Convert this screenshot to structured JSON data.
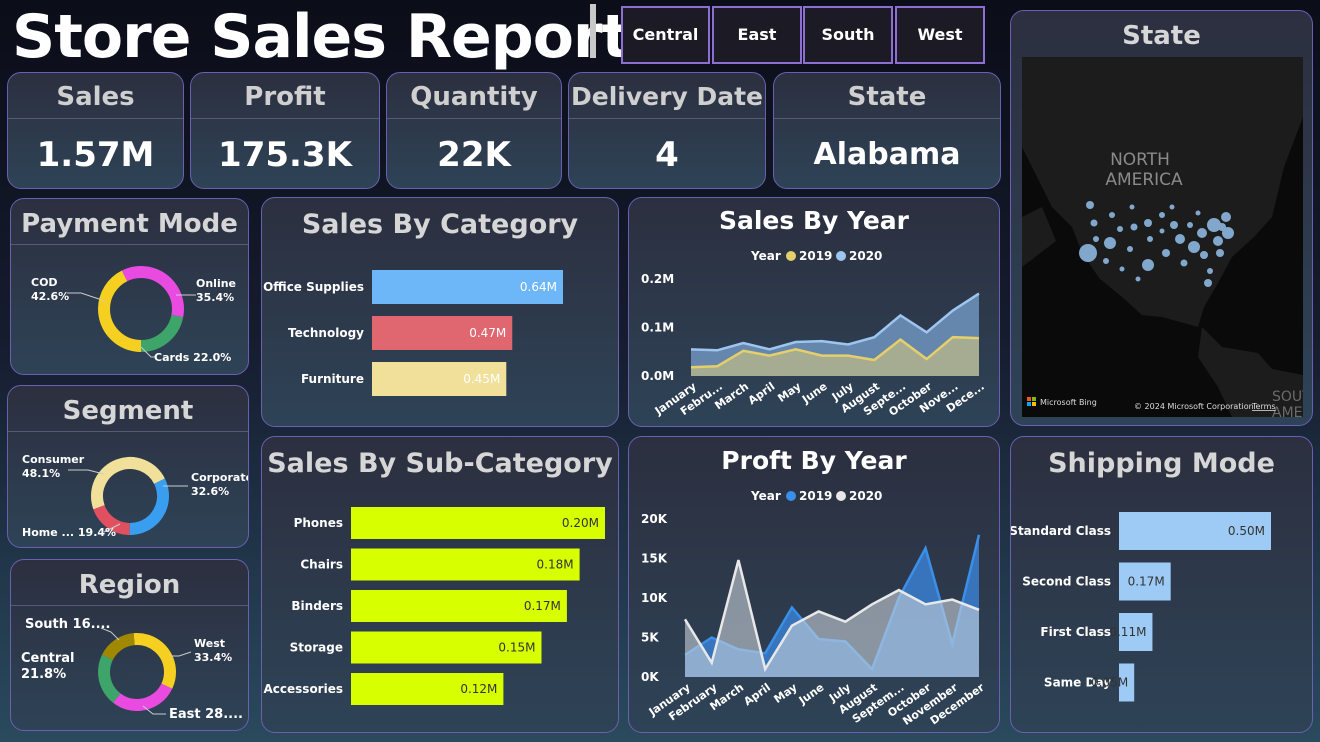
{
  "report_title": "Store Sales Report",
  "region_slicer": [
    "Central",
    "East",
    "South",
    "West"
  ],
  "kpis": {
    "sales": {
      "label": "Sales",
      "value": "1.57M"
    },
    "profit": {
      "label": "Profit",
      "value": "175.3K"
    },
    "quantity": {
      "label": "Quantity",
      "value": "22K"
    },
    "delivery": {
      "label": "Delivery Date",
      "value": "4"
    },
    "state": {
      "label": "State",
      "value": "Alabama"
    }
  },
  "map": {
    "title": "State",
    "continent_line1": "NORTH",
    "continent_line2": "AMERICA",
    "south_label_line1": "SOUT",
    "south_label_line2": "AMER",
    "bing": "Microsoft Bing",
    "copyright": "© 2024 Microsoft Corporation",
    "terms": "Terms"
  },
  "colors": {
    "accent_border": "#6a5fb0",
    "office_supplies": "#6db6f7",
    "technology": "#e06670",
    "furniture": "#f0e09a",
    "subcategory": "#d8ff00",
    "shipping": "#9ecbf5",
    "year_2019_sales": "#e5cf6a",
    "year_2020_sales": "#9ec5f0",
    "year_2019_profit": "#3a8fe8",
    "year_2020_profit": "#e8e8e8"
  },
  "chart_data": [
    {
      "id": "payment_mode",
      "type": "pie",
      "title": "Payment Mode",
      "slices": [
        {
          "label": "COD",
          "value_label": "42.6%",
          "value": 42.6,
          "color": "#f5d020"
        },
        {
          "label": "Online",
          "value_label": "35.4%",
          "value": 35.4,
          "color": "#e94be0"
        },
        {
          "label": "Cards",
          "value_label": "22.0%",
          "value": 22.0,
          "color": "#3ea56a"
        }
      ]
    },
    {
      "id": "segment",
      "type": "pie",
      "title": "Segment",
      "slices": [
        {
          "label": "Consumer",
          "value_label": "48.1%",
          "value": 48.1,
          "color": "#f0e09a"
        },
        {
          "label": "Corporate",
          "value_label": "32.6%",
          "value": 32.6,
          "color": "#3a9ef0"
        },
        {
          "label": "Home ...",
          "value_label": "19.4%",
          "value": 19.4,
          "color": "#e05060"
        }
      ]
    },
    {
      "id": "region",
      "type": "pie",
      "title": "Region",
      "slices": [
        {
          "label": "West",
          "value_label": "33.4%",
          "value": 33.4,
          "color": "#f5d020"
        },
        {
          "label": "East",
          "value_label": "28....",
          "value": 28.4,
          "color": "#e94be0"
        },
        {
          "label": "Central",
          "value_label": "21.8%",
          "value": 21.8,
          "color": "#3ea56a"
        },
        {
          "label": "South",
          "value_label": "16....",
          "value": 16.4,
          "color": "#a08800"
        }
      ]
    },
    {
      "id": "sales_by_category",
      "type": "bar",
      "title": "Sales By Category",
      "categories": [
        "Office Supplies",
        "Technology",
        "Furniture"
      ],
      "values": [
        0.64,
        0.47,
        0.45
      ],
      "value_labels": [
        "0.64M",
        "0.47M",
        "0.45M"
      ],
      "bar_colors": [
        "#6db6f7",
        "#e06670",
        "#f0e09a"
      ],
      "xlim": [
        0,
        0.64
      ]
    },
    {
      "id": "sales_by_subcategory",
      "type": "bar",
      "title": "Sales By Sub-Category",
      "categories": [
        "Phones",
        "Chairs",
        "Binders",
        "Storage",
        "Accessories"
      ],
      "values": [
        0.2,
        0.18,
        0.17,
        0.15,
        0.12
      ],
      "value_labels": [
        "0.20M",
        "0.18M",
        "0.17M",
        "0.15M",
        "0.12M"
      ],
      "xlim": [
        0,
        0.2
      ]
    },
    {
      "id": "shipping_mode",
      "type": "bar",
      "title": "Shipping Mode",
      "categories": [
        "Standard Class",
        "Second Class",
        "First Class",
        "Same Day"
      ],
      "values": [
        0.5,
        0.17,
        0.11,
        0.05
      ],
      "value_labels": [
        "0.50M",
        "0.17M",
        "0.11M",
        "0.05M"
      ],
      "xlim": [
        0,
        0.5
      ]
    },
    {
      "id": "sales_by_year",
      "type": "area",
      "title": "Sales By Year",
      "legend_title": "Year",
      "categories": [
        "January",
        "Febru...",
        "March",
        "April",
        "May",
        "June",
        "July",
        "August",
        "Septe...",
        "October",
        "Nove...",
        "Dece..."
      ],
      "yticks": [
        "0.0M",
        "0.1M",
        "0.2M"
      ],
      "ylim": [
        0,
        0.2
      ],
      "series": [
        {
          "name": "2020",
          "values": [
            0.055,
            0.053,
            0.068,
            0.055,
            0.07,
            0.072,
            0.065,
            0.08,
            0.125,
            0.09,
            0.135,
            0.17
          ]
        },
        {
          "name": "2019",
          "values": [
            0.018,
            0.02,
            0.052,
            0.042,
            0.055,
            0.042,
            0.042,
            0.033,
            0.075,
            0.035,
            0.08,
            0.078
          ]
        }
      ]
    },
    {
      "id": "profit_by_year",
      "type": "area",
      "title": "Proft By Year",
      "legend_title": "Year",
      "categories": [
        "January",
        "February",
        "March",
        "April",
        "May",
        "June",
        "July",
        "August",
        "Septem...",
        "October",
        "November",
        "December"
      ],
      "yticks": [
        "0K",
        "5K",
        "10K",
        "15K",
        "20K"
      ],
      "ylim": [
        0,
        20000
      ],
      "series": [
        {
          "name": "2019",
          "values": [
            2800,
            5000,
            3500,
            3000,
            8800,
            4800,
            4500,
            1000,
            10000,
            16300,
            4200,
            18000
          ]
        },
        {
          "name": "2020",
          "values": [
            7300,
            1800,
            14800,
            1000,
            6500,
            8300,
            7000,
            9200,
            11000,
            9200,
            9800,
            8500
          ]
        }
      ]
    }
  ]
}
